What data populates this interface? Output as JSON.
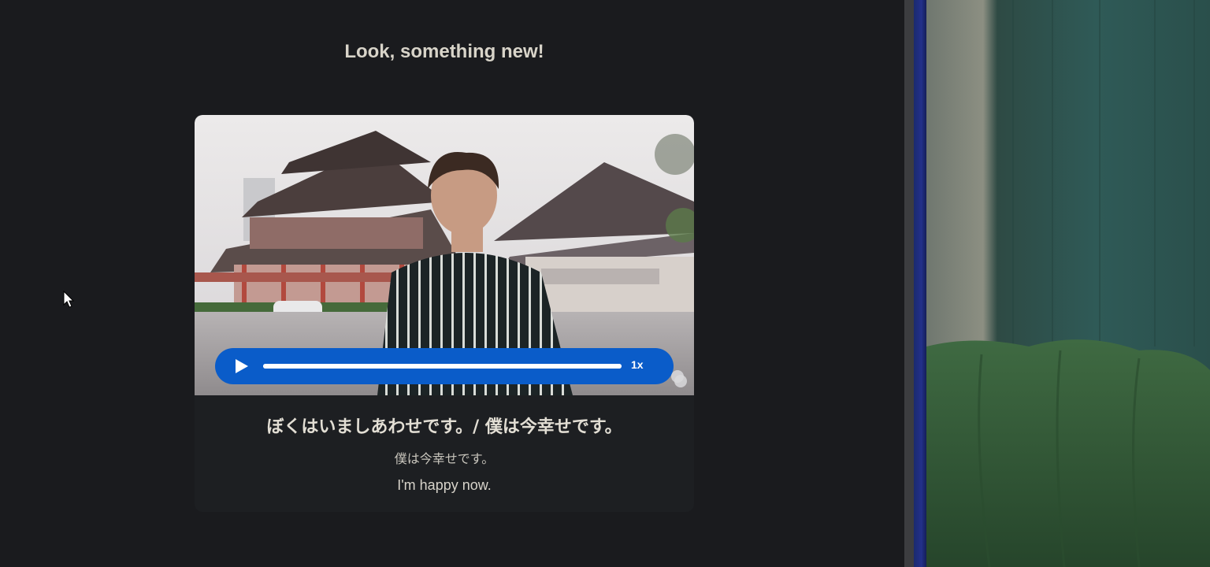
{
  "lesson": {
    "heading": "Look, something new!",
    "phrase": "ぼくはいましあわせです。/ 僕は今幸せです。",
    "kanji": "僕は今幸せです。",
    "translation": "I'm happy now."
  },
  "player": {
    "play_icon": "play-icon",
    "speed_label": "1x",
    "progress": 1.0,
    "accent_color": "#0a5cc9"
  },
  "icons": {
    "cursor": "cursor-icon",
    "bubble": "chat-bubble-icon"
  }
}
